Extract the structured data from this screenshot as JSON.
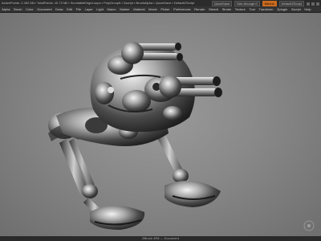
{
  "titlebar": {
    "stats": "ActivePoints: 2.452 Mil  ▪  TotalPoints: 10.73 Mil  ▪  ScrollableEdgeLoops  ▪  PolyGroupIt  ▪  Zscript  ▪  BrushAlpha  ▪  QuickSave  ▪  DefaultZScript",
    "quicksave_label": "QuickSave",
    "see_through_label": "See-through 0",
    "menus_label": "Menus",
    "default_script_label": "DefaultZScript"
  },
  "menus": [
    "Alpha",
    "Brush",
    "Color",
    "Document",
    "Draw",
    "Edit",
    "File",
    "Layer",
    "Light",
    "Macro",
    "Marker",
    "Material",
    "Movie",
    "Picker",
    "Preferences",
    "Render",
    "Stencil",
    "Stroke",
    "Texture",
    "Tool",
    "Transform",
    "Zplugin",
    "Zscript",
    "Help"
  ],
  "status": {
    "text": "ZBrush 4R8 — Document"
  },
  "icons": {
    "gizmo": "navigation-gizmo-icon",
    "min": "minimize-icon",
    "max": "maximize-icon",
    "close": "close-icon"
  }
}
